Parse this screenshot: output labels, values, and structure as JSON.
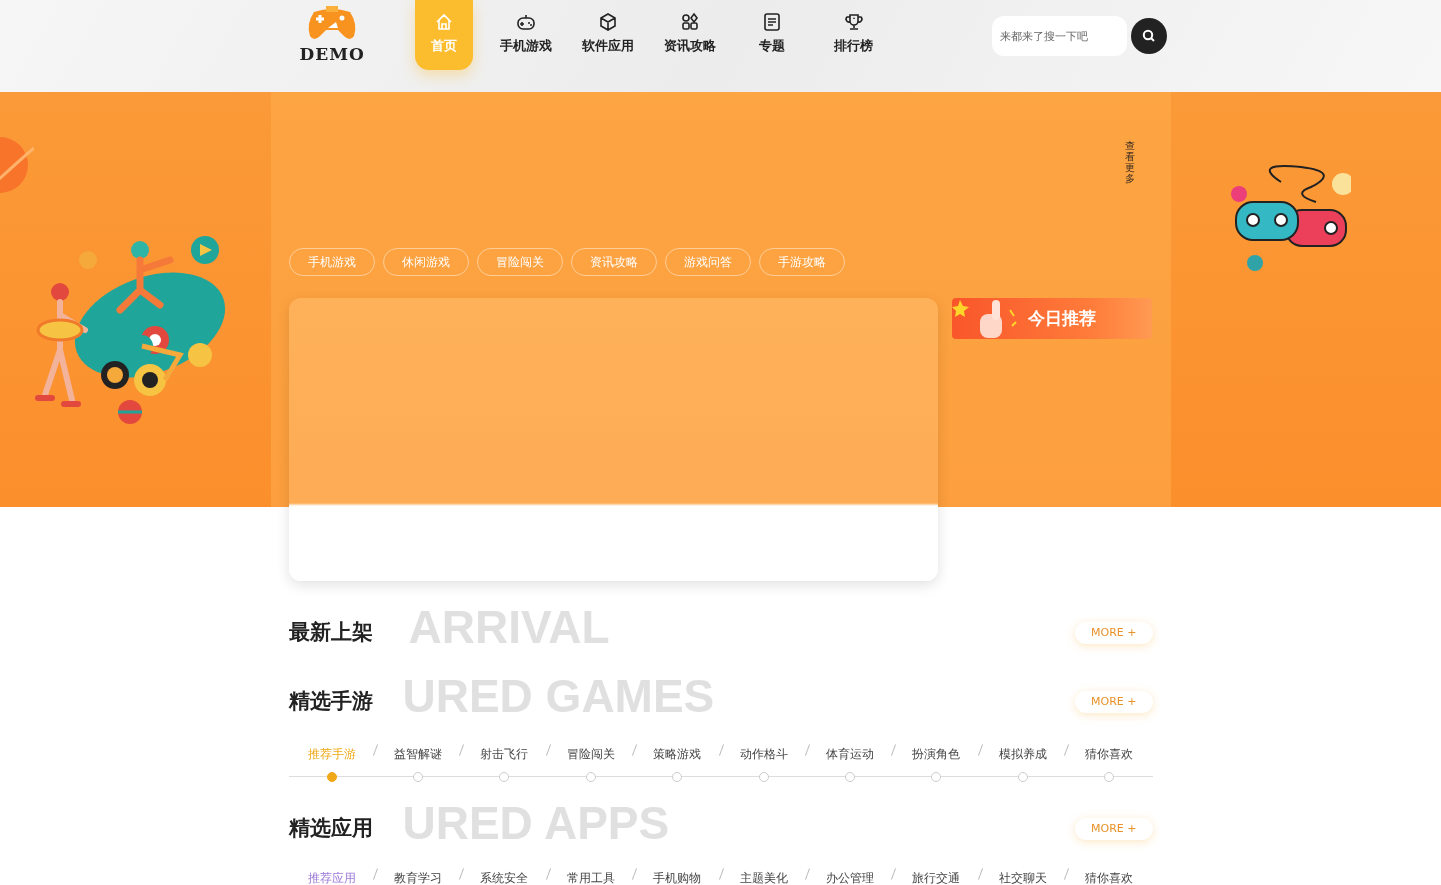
{
  "header": {
    "logo_text": "DEMO",
    "nav": [
      {
        "label": "首页",
        "kind": "home",
        "selected": true
      },
      {
        "label": "手机游戏",
        "kind": "gamepad",
        "selected": false
      },
      {
        "label": "软件应用",
        "kind": "cube",
        "selected": false
      },
      {
        "label": "资讯攻略",
        "kind": "grid",
        "selected": false
      },
      {
        "label": "专题",
        "kind": "document",
        "selected": false
      },
      {
        "label": "排行榜",
        "kind": "trophy",
        "selected": false
      }
    ],
    "search": {
      "placeholder": "来都来了搜一下吧"
    }
  },
  "banner": {
    "side_label": "查看更多",
    "tags": [
      "手机游戏",
      "休闲游戏",
      "冒险闯关",
      "资讯攻略",
      "游戏问答",
      "手游攻略"
    ],
    "recommend": "今日推荐"
  },
  "sections": [
    {
      "title": "最新上架",
      "backdrop": "ARRIVAL",
      "more": "MORE +"
    },
    {
      "title": "精选手游",
      "backdrop": "URED GAMES",
      "more": "MORE +",
      "color": "#f0a818",
      "indicator_dots": true,
      "tabs": [
        {
          "label": "推荐手游",
          "selected": true
        },
        {
          "label": "益智解谜",
          "selected": false
        },
        {
          "label": "射击飞行",
          "selected": false
        },
        {
          "label": "冒险闯关",
          "selected": false
        },
        {
          "label": "策略游戏",
          "selected": false
        },
        {
          "label": "动作格斗",
          "selected": false
        },
        {
          "label": "体育运动",
          "selected": false
        },
        {
          "label": "扮演角色",
          "selected": false
        },
        {
          "label": "模拟养成",
          "selected": false
        },
        {
          "label": "猜你喜欢",
          "selected": false
        }
      ]
    },
    {
      "title": "精选应用",
      "backdrop": "URED APPS",
      "more": "MORE +",
      "color": "#9d7ad8",
      "tabs": [
        {
          "label": "推荐应用",
          "selected": true
        },
        {
          "label": "教育学习",
          "selected": false
        },
        {
          "label": "系统安全",
          "selected": false
        },
        {
          "label": "常用工具",
          "selected": false
        },
        {
          "label": "手机购物",
          "selected": false
        },
        {
          "label": "主题美化",
          "selected": false
        },
        {
          "label": "办公管理",
          "selected": false
        },
        {
          "label": "旅行交通",
          "selected": false
        },
        {
          "label": "社交聊天",
          "selected": false
        },
        {
          "label": "猜你喜欢",
          "selected": false
        }
      ]
    }
  ]
}
